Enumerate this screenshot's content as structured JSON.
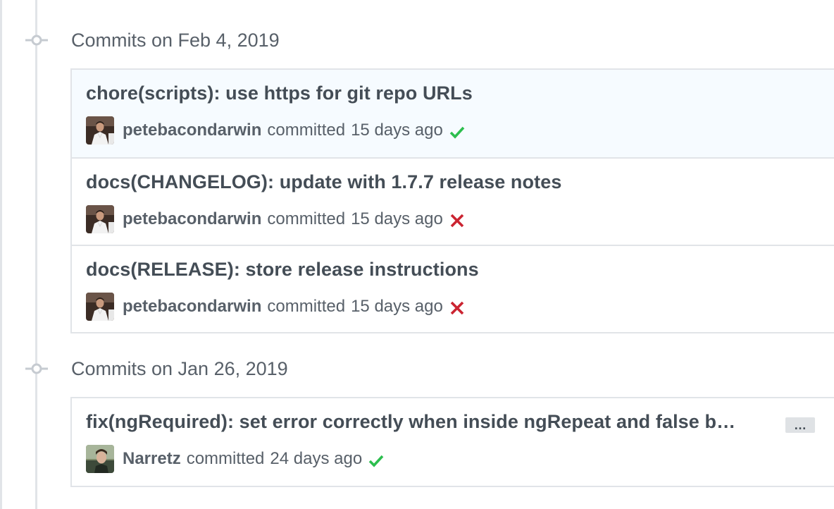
{
  "colors": {
    "success": "#2cbe4e",
    "failure": "#cb2431",
    "timeline": "#e1e4e8",
    "highlight_bg": "#f6fbff"
  },
  "groups": [
    {
      "title": "Commits on Feb 4, 2019",
      "commits": [
        {
          "message": "chore(scripts): use https for git repo URLs",
          "author": "petebacondarwin",
          "action": "committed",
          "time": "15 days ago",
          "status": "success",
          "status_icon": "check-icon"
        },
        {
          "message": "docs(CHANGELOG): update with 1.7.7 release notes",
          "author": "petebacondarwin",
          "action": "committed",
          "time": "15 days ago",
          "status": "failure",
          "status_icon": "x-icon"
        },
        {
          "message": "docs(RELEASE): store release instructions",
          "author": "petebacondarwin",
          "action": "committed",
          "time": "15 days ago",
          "status": "failure",
          "status_icon": "x-icon"
        }
      ]
    },
    {
      "title": "Commits on Jan 26, 2019",
      "commits": [
        {
          "message": "fix(ngRequired): set error correctly when inside ngRepeat and false b…",
          "author": "Narretz",
          "action": "committed",
          "time": "24 days ago",
          "status": "success",
          "status_icon": "check-icon",
          "expand_label": "…"
        }
      ]
    }
  ]
}
